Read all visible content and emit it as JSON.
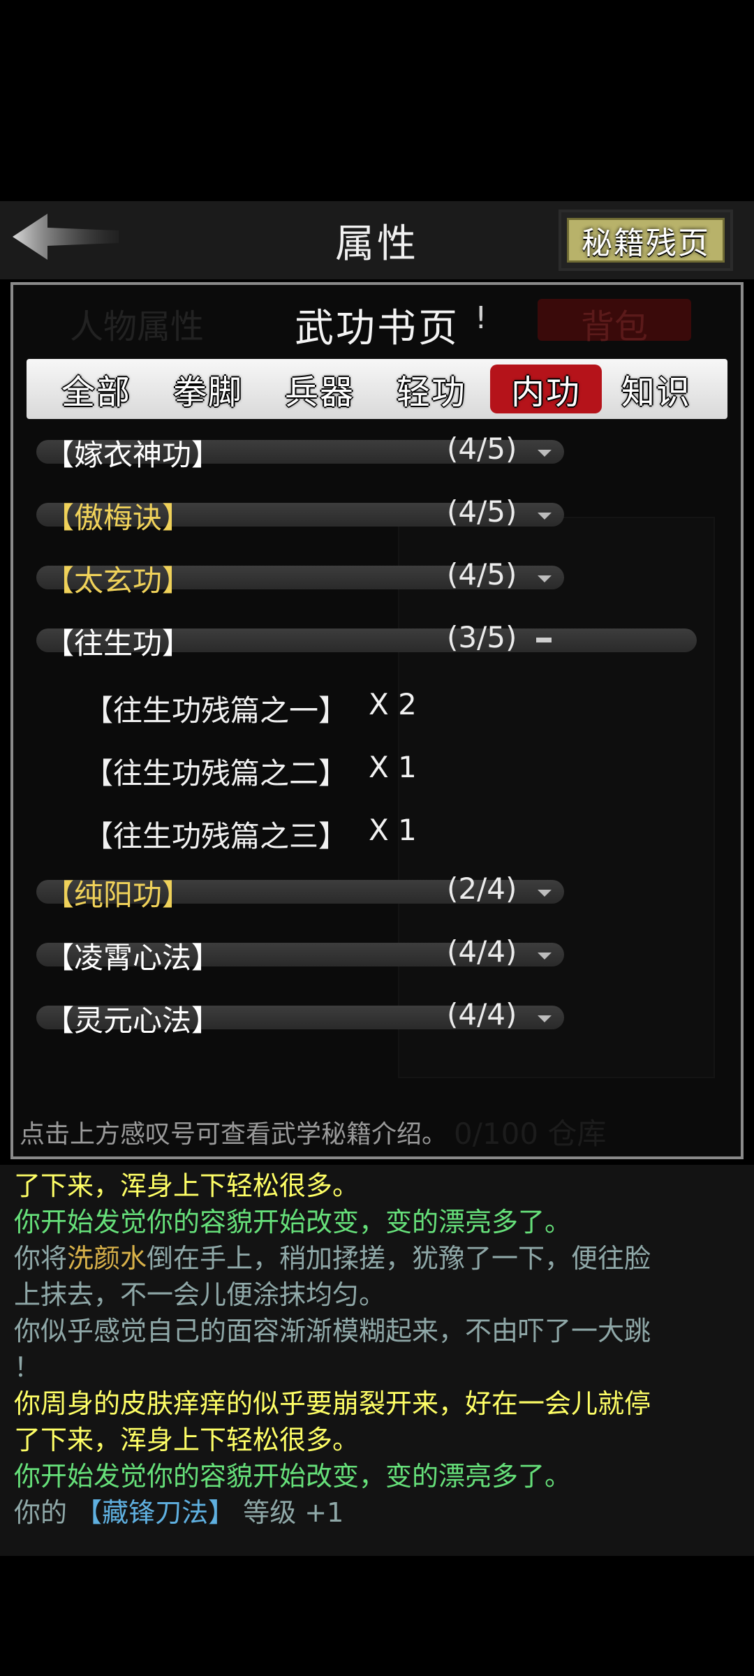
{
  "header": {
    "title": "属性",
    "fragments_button": "秘籍残页"
  },
  "background_panel": {
    "tab_left": "人物属性",
    "tab_right": "背包",
    "storage": "0/100 仓库"
  },
  "dialog": {
    "title": "武功书页",
    "info_mark": "!",
    "tabs": [
      "全部",
      "拳脚",
      "兵器",
      "轻功",
      "内功",
      "知识"
    ],
    "active_tab": "内功",
    "rows": [
      {
        "name": "【嫁衣神功】",
        "count": "(4/5)",
        "color": "#ffffff",
        "expanded": false
      },
      {
        "name": "【傲梅诀】",
        "count": "(4/5)",
        "color": "#f0d25a",
        "expanded": false
      },
      {
        "name": "【太玄功】",
        "count": "(4/5)",
        "color": "#f0d25a",
        "expanded": false
      },
      {
        "name": "【往生功】",
        "count": "(3/5)",
        "color": "#ffffff",
        "expanded": true
      },
      {
        "name": "【纯阳功】",
        "count": "(2/4)",
        "color": "#f0d25a",
        "expanded": false
      },
      {
        "name": "【凌霄心法】",
        "count": "(4/4)",
        "color": "#ffffff",
        "expanded": false
      },
      {
        "name": "【灵元心法】",
        "count": "(4/4)",
        "color": "#ffffff",
        "expanded": false
      }
    ],
    "sub_items": [
      {
        "name": "【往生功残篇之一】",
        "qty": "X 2"
      },
      {
        "name": "【往生功残篇之二】",
        "qty": "X 1"
      },
      {
        "name": "【往生功残篇之三】",
        "qty": "X 1"
      }
    ],
    "hint": "点击上方感叹号可查看武学秘籍介绍。"
  },
  "log": {
    "lines": [
      {
        "segments": [
          {
            "text": "了下来，浑身上下轻松很多。",
            "color": "#ffff66"
          }
        ]
      },
      {
        "segments": [
          {
            "text": "你开始发觉你的容貌开始改变，变的漂亮多了。",
            "color": "#66e07a"
          }
        ]
      },
      {
        "segments": [
          {
            "text": "你将",
            "color": "#8fa8a8"
          },
          {
            "text": "洗颜水",
            "color": "#d9b24a"
          },
          {
            "text": "倒在手上，稍加揉搓，犹豫了一下，便往脸",
            "color": "#8fa8a8"
          }
        ]
      },
      {
        "segments": [
          {
            "text": "上抹去，不一会儿便涂抹均匀。",
            "color": "#8fa8a8"
          }
        ]
      },
      {
        "segments": [
          {
            "text": "你似乎感觉自己的面容渐渐模糊起来，不由吓了一大跳",
            "color": "#8fa8a8"
          }
        ]
      },
      {
        "segments": [
          {
            "text": "！",
            "color": "#8fa8a8"
          }
        ]
      },
      {
        "segments": [
          {
            "text": "你周身的皮肤痒痒的似乎要崩裂开来，好在一会儿就停",
            "color": "#ffff66"
          }
        ]
      },
      {
        "segments": [
          {
            "text": "了下来，浑身上下轻松很多。",
            "color": "#ffff66"
          }
        ]
      },
      {
        "segments": [
          {
            "text": "你开始发觉你的容貌开始改变，变的漂亮多了。",
            "color": "#66e07a"
          }
        ]
      },
      {
        "segments": [
          {
            "text": "你的 ",
            "color": "#8fa8a8"
          },
          {
            "text": "【藏锋刀法】",
            "color": "#5fb0e0"
          },
          {
            "text": " 等级 +1",
            "color": "#8fa8a8"
          }
        ]
      }
    ]
  }
}
